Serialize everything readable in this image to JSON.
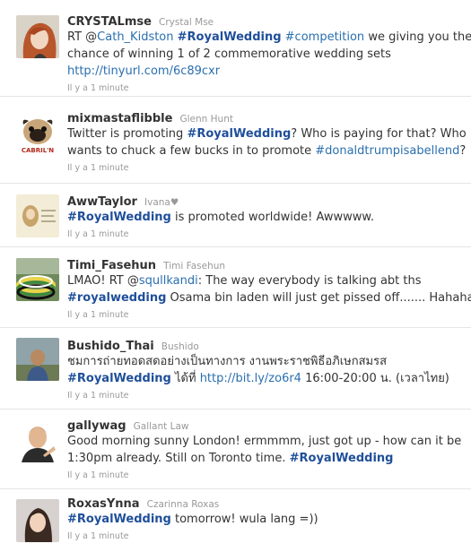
{
  "tweets": [
    {
      "screen_name": "CRYSTALmse",
      "real_name": "Crystal Mse",
      "avatar": "avatar-crystal",
      "lines": [
        [
          {
            "t": "text",
            "v": "RT @"
          },
          {
            "t": "link",
            "v": "Cath_Kidston"
          },
          {
            "t": "text",
            "v": " "
          },
          {
            "t": "tag",
            "v": "#RoyalWedding"
          },
          {
            "t": "text",
            "v": " "
          },
          {
            "t": "link",
            "v": "#competition"
          },
          {
            "t": "text",
            "v": " we giving you the"
          }
        ],
        [
          {
            "t": "text",
            "v": "chance of winning 1 of 2 commemorative wedding sets"
          }
        ],
        [
          {
            "t": "link",
            "v": "http://tinyurl.com/6c89cxr"
          }
        ]
      ],
      "timestamp": "Il y a 1 minute"
    },
    {
      "screen_name": "mixmastaflibble",
      "real_name": "Glenn Hunt",
      "avatar": "avatar-pug",
      "lines": [
        [
          {
            "t": "text",
            "v": "Twitter is promoting "
          },
          {
            "t": "tag",
            "v": "#RoyalWedding"
          },
          {
            "t": "text",
            "v": "? Who is paying for that? Who"
          }
        ],
        [
          {
            "t": "text",
            "v": "wants to chuck a few bucks in to promote "
          },
          {
            "t": "link",
            "v": "#donaldtrumpisabellend"
          },
          {
            "t": "text",
            "v": "?"
          }
        ]
      ],
      "timestamp": "Il y a 1 minute"
    },
    {
      "screen_name": "AwwTaylor",
      "real_name": "Ivana♥",
      "avatar": "avatar-aww",
      "lines": [
        [
          {
            "t": "tag",
            "v": "#RoyalWedding"
          },
          {
            "t": "text",
            "v": " is promoted worldwide! Awwwww."
          }
        ]
      ],
      "timestamp": "Il y a 1 minute"
    },
    {
      "screen_name": "Timi_Fasehun",
      "real_name": "Timi Fasehun",
      "avatar": "avatar-bracelets",
      "lines": [
        [
          {
            "t": "text",
            "v": "LMAO! RT @"
          },
          {
            "t": "link",
            "v": "squllkandi"
          },
          {
            "t": "text",
            "v": ": The way everybody is talking abt ths"
          }
        ],
        [
          {
            "t": "tag",
            "v": "#royalwedding"
          },
          {
            "t": "text",
            "v": " Osama bin laden will just get pissed off....... Hahaha"
          }
        ]
      ],
      "timestamp": "Il y a 1 minute"
    },
    {
      "screen_name": "Bushido_Thai",
      "real_name": "Bushido",
      "avatar": "avatar-bushido",
      "lines": [
        [
          {
            "t": "text",
            "v": "ชมการถ่ายทอดสดอย่างเป็นทางการ งานพระราชพิธีอภิเษกสมรส"
          }
        ],
        [
          {
            "t": "tag",
            "v": "#RoyalWedding"
          },
          {
            "t": "text",
            "v": " ได้ที่ "
          },
          {
            "t": "link",
            "v": "http://bit.ly/zo6r4"
          },
          {
            "t": "text",
            "v": " 16:00-20:00 น. (เวลาไทย)"
          }
        ]
      ],
      "timestamp": "Il y a 1 minute"
    },
    {
      "screen_name": "gallywag",
      "real_name": "Gallant Law",
      "avatar": "avatar-gallywag",
      "lines": [
        [
          {
            "t": "text",
            "v": "Good morning sunny London! ermmmm, just got up - how can it be"
          }
        ],
        [
          {
            "t": "text",
            "v": "1:30pm already. Still on Toronto time. "
          },
          {
            "t": "tag",
            "v": "#RoyalWedding"
          }
        ]
      ],
      "timestamp": "Il y a 1 minute"
    },
    {
      "screen_name": "RoxasYnna",
      "real_name": "Czarinna Roxas",
      "avatar": "avatar-roxas",
      "lines": [
        [
          {
            "t": "tag",
            "v": "#RoyalWedding"
          },
          {
            "t": "text",
            "v": " tomorrow! wula lang =))"
          }
        ]
      ],
      "timestamp": "Il y a 1 minute"
    }
  ],
  "colors": {
    "link": "#2a6fb0",
    "hashtag": "#1f4f9a",
    "text": "#333333",
    "meta": "#999999",
    "divider": "#e5e5e5"
  }
}
